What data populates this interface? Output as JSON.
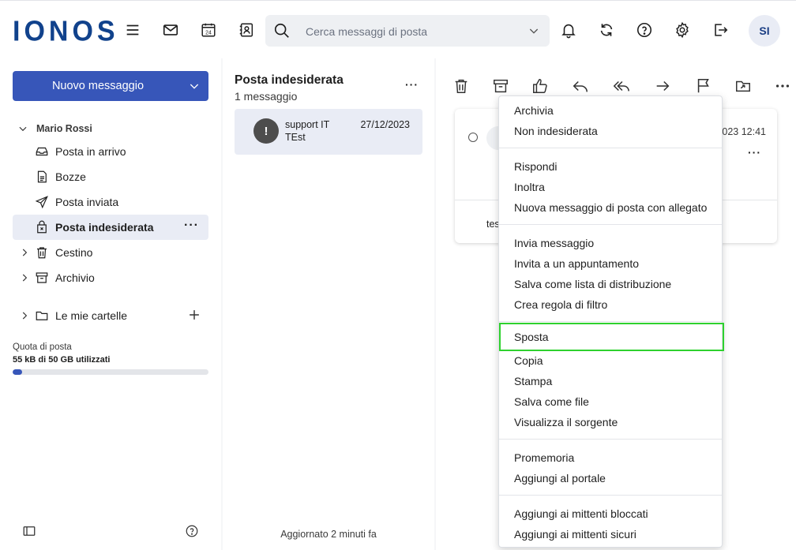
{
  "header": {
    "logo": "IONOS",
    "calendar_day": "24",
    "search_placeholder": "Cerca messaggi di posta",
    "avatar_initials": "SI"
  },
  "sidebar": {
    "new_message": "Nuovo messaggio",
    "account_name": "Mario Rossi",
    "folders": [
      {
        "label": "Posta in arrivo",
        "icon": "inbox-icon"
      },
      {
        "label": "Bozze",
        "icon": "drafts-icon"
      },
      {
        "label": "Posta inviata",
        "icon": "sent-icon"
      },
      {
        "label": "Posta indesiderata",
        "icon": "spam-icon",
        "active": true
      },
      {
        "label": "Cestino",
        "icon": "trash-icon"
      },
      {
        "label": "Archivio",
        "icon": "archive-icon"
      }
    ],
    "my_folders": "Le mie cartelle",
    "quota_label": "Quota di posta",
    "quota_used": "55 kB di 50 GB utilizzati",
    "quota_fraction": 0.05
  },
  "message_list": {
    "title": "Posta indesiderata",
    "count": "1 messaggio",
    "messages": [
      {
        "from": "support IT",
        "subject": "TEst",
        "date": "27/12/2023",
        "avatar": "!"
      }
    ],
    "footer": "Aggiornato 2 minuti fa"
  },
  "reading_pane": {
    "time_partial": "023 12:41",
    "body_partial": "tes"
  },
  "context_menu": {
    "groups": [
      [
        "Archivia",
        "Non indesiderata"
      ],
      [
        "Rispondi",
        "Inoltra",
        "Nuova messaggio di posta con allegato"
      ],
      [
        "Invia messaggio",
        "Invita a un appuntamento",
        "Salva come lista di distribuzione",
        "Crea regola di filtro"
      ],
      [
        "Sposta",
        "Copia",
        "Stampa",
        "Salva come file",
        "Visualizza il sorgente"
      ],
      [
        "Promemoria",
        "Aggiungi al portale"
      ],
      [
        "Aggiungi ai mittenti bloccati",
        "Aggiungi ai mittenti sicuri"
      ]
    ],
    "highlighted": "Sposta",
    "highlight_color": "#2ed12e"
  },
  "colors": {
    "brand": "#11428c",
    "primary_button": "#3756b9",
    "selected_bg": "#e9ecf5"
  }
}
